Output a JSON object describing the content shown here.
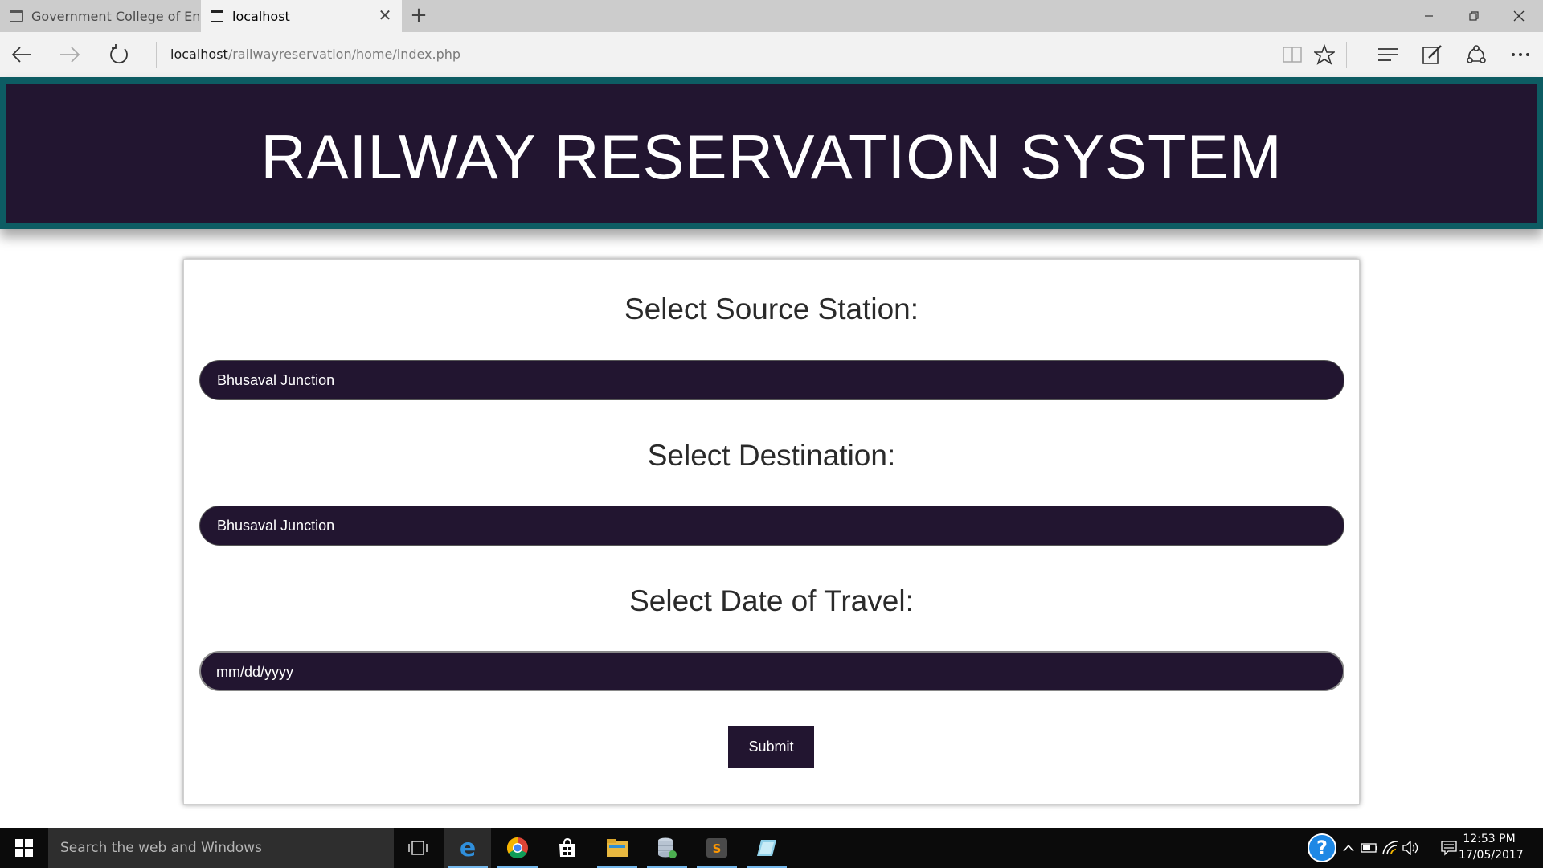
{
  "browser": {
    "tabs": [
      {
        "label": "Government College of Engi",
        "active": false,
        "icon": "page-icon"
      },
      {
        "label": "localhost",
        "active": true,
        "icon": "page-icon"
      }
    ],
    "close_tab_icon": "close-icon",
    "new_tab_icon": "plus-icon",
    "window_controls": [
      "minimize-icon",
      "restore-icon",
      "close-icon"
    ],
    "nav": {
      "back": "back-arrow-icon",
      "forward": "forward-arrow-icon",
      "refresh": "refresh-icon"
    },
    "url": {
      "host": "localhost",
      "path": "/railwayreservation/home/index.php"
    },
    "toolbar": [
      "reading-view-icon",
      "favorite-star-icon",
      "hub-icon",
      "web-note-icon",
      "share-icon",
      "more-icon"
    ]
  },
  "page": {
    "title": "RAILWAY RESERVATION SYSTEM",
    "source": {
      "label": "Select Source Station:",
      "value": "Bhusaval Junction"
    },
    "destination": {
      "label": "Select Destination:",
      "value": "Bhusaval Junction"
    },
    "date": {
      "label": "Select Date of Travel:",
      "placeholder": "mm/dd/yyyy"
    },
    "submit_label": "Submit"
  },
  "taskbar": {
    "search_placeholder": "Search the web and Windows",
    "apps": [
      "task-view-icon",
      "edge-icon",
      "chrome-icon",
      "store-icon",
      "file-explorer-icon",
      "database-icon",
      "sublime-text-icon",
      "tablet-icon"
    ],
    "active_app": "edge-icon",
    "clock": {
      "time": "12:53 PM",
      "date": "17/05/2017"
    }
  },
  "colors": {
    "header_bg": "#221530",
    "header_border": "#0d5c63",
    "pill_bg": "#221530",
    "taskbar_bg": "#0b0b0b",
    "tabbar_bg": "#cccccc",
    "accent": "#76b9ed"
  }
}
